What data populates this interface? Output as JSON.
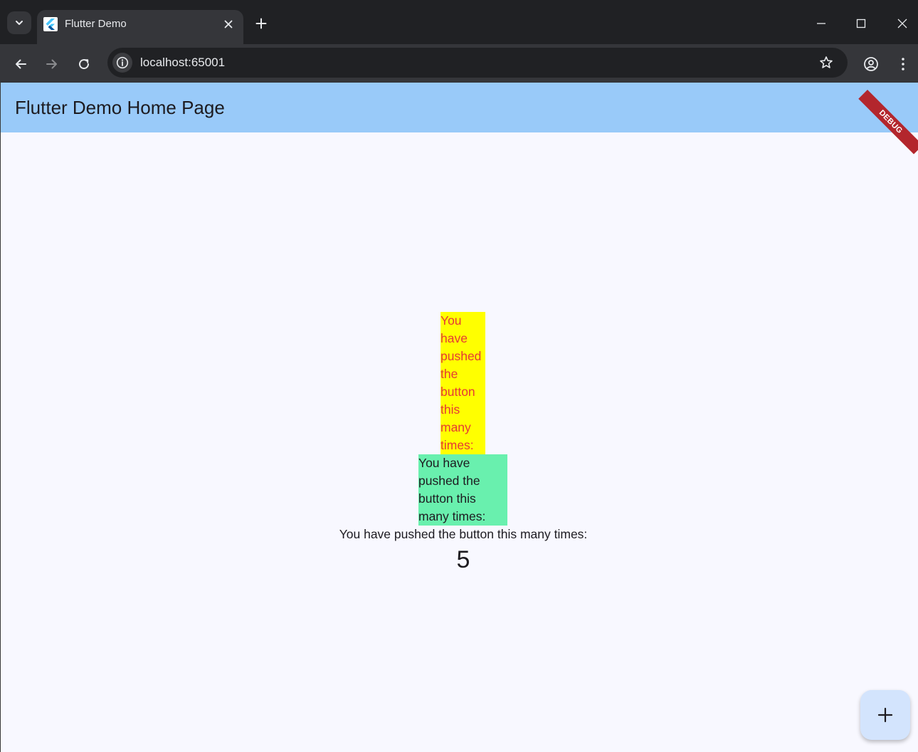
{
  "browser": {
    "tab_title": "Flutter Demo",
    "url": "localhost:65001"
  },
  "app": {
    "title": "Flutter Demo Home Page",
    "debug_banner": "DEBUG",
    "yellow_text": "You have pushed the button this many times:",
    "green_text": "You have pushed the button this many times:",
    "plain_text": "You have pushed the button this many times:",
    "counter": "5"
  },
  "icons": {
    "tab_search": "chevron-down-icon",
    "favicon": "flutter-logo-icon",
    "tab_close": "close-icon",
    "new_tab": "plus-icon",
    "back": "arrow-left-icon",
    "forward": "arrow-right-icon",
    "reload": "reload-icon",
    "site_info": "info-icon",
    "bookmark": "star-icon",
    "profile": "account-icon",
    "menu": "more-vert-icon",
    "fab": "plus-icon"
  },
  "colors": {
    "appbar": "#99caf9",
    "background": "#f8f8ff",
    "yellow_box": "#ffff00",
    "yellow_text": "#e53935",
    "green_box": "#69f0ae",
    "fab": "#d3e4fd",
    "debug_banner": "#b3262d"
  }
}
